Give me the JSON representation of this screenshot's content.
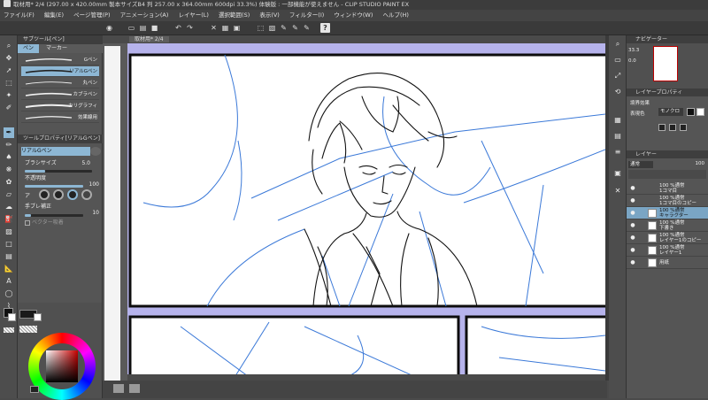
{
  "window": {
    "title": "取材用* 2/4 (297.00 x 420.00mm 製本サイズB4 判 257.00 x 364.00mm 600dpi 33.3%) 体験版 : 一部機能が使えません - CLIP STUDIO PAINT EX"
  },
  "menu": [
    "ファイル(F)",
    "編集(E)",
    "ページ管理(P)",
    "アニメーション(A)",
    "レイヤー(L)",
    "選択範囲(S)",
    "表示(V)",
    "フィルター(I)",
    "ウィンドウ(W)",
    "ヘルプ(H)"
  ],
  "subtool": {
    "panel_title": "サブツール[ペン]",
    "tabs": [
      "ペン",
      "マーカー"
    ],
    "active_tab": "ペン",
    "brushes": [
      "Gペン",
      "リアルGペン",
      "丸ペン",
      "カブラペン",
      "カリグラフィ",
      "効果線用"
    ],
    "active_brush": "リアルGペン"
  },
  "tool_property": {
    "title": "ツールプロパティ[リアルGペン]",
    "brush_name": "リアルGペン",
    "brush_size_label": "ブラシサイズ",
    "brush_size_value": "5.0",
    "opacity_label": "不透明度",
    "opacity_value": "100",
    "opacity_level": 1.0,
    "anti_alias_label": "アンチエイリアス",
    "stabilization_label": "手ブレ補正",
    "stabilization_value": "10",
    "vector_label": "ベクター吸着"
  },
  "canvas": {
    "tab_label": "取材用* 2/4",
    "colors": {
      "page_bg": "#b6b3ec",
      "panel_border": "#0d0d0d",
      "blue_line": "#3b79d8",
      "ink": "#121212"
    }
  },
  "navigator": {
    "title": "ナビゲーター",
    "zoom": "33.3",
    "rotate": "0.0"
  },
  "layer_property": {
    "title": "レイヤープロパティ",
    "effect_label": "境界効果",
    "expression_label": "表現色",
    "expression_value": "モノクロ"
  },
  "layers": {
    "title": "レイヤー",
    "blend_mode": "通常",
    "opacity": "100",
    "rows": [
      {
        "percent": "100 %通常",
        "name": "1コマ目"
      },
      {
        "percent": "100 %通常",
        "name": "1コマ目のコピー"
      },
      {
        "percent": "100 %通常",
        "name": "キャラクター",
        "selected": true
      },
      {
        "percent": "100 %通常",
        "name": "下書き"
      },
      {
        "percent": "100 %通常",
        "name": "レイヤー1のコピー"
      },
      {
        "percent": "100 %通常",
        "name": "レイヤー1"
      },
      {
        "percent": "",
        "name": "用紙"
      }
    ]
  }
}
